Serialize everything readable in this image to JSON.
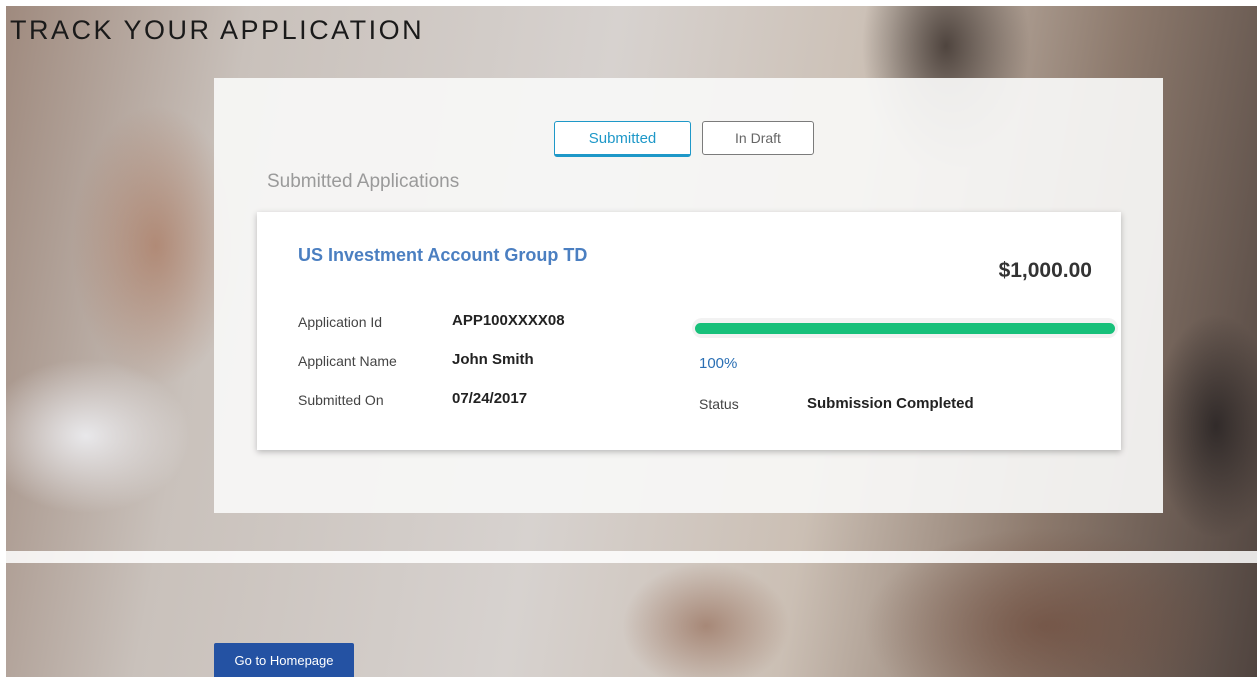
{
  "page": {
    "title": "TRACK YOUR APPLICATION"
  },
  "tabs": [
    {
      "label": "Submitted",
      "active": true
    },
    {
      "label": "In Draft",
      "active": false
    }
  ],
  "section": {
    "heading": "Submitted Applications"
  },
  "application": {
    "title": "US Investment Account Group TD",
    "amount": "$1,000.00",
    "fields": {
      "application_id": {
        "label": "Application Id",
        "value": "APP100XXXX08"
      },
      "applicant_name": {
        "label": "Applicant Name",
        "value": "John Smith"
      },
      "submitted_on": {
        "label": "Submitted On",
        "value": "07/24/2017"
      }
    },
    "progress": {
      "percent": 100,
      "label": "100%",
      "color": "#17c07a"
    },
    "status": {
      "label": "Status",
      "value": "Submission Completed"
    }
  },
  "footer": {
    "home_button_label": "Go to Homepage"
  },
  "colors": {
    "accent": "#1e98c8",
    "link": "#4b7fc1",
    "button": "#2452a3"
  }
}
